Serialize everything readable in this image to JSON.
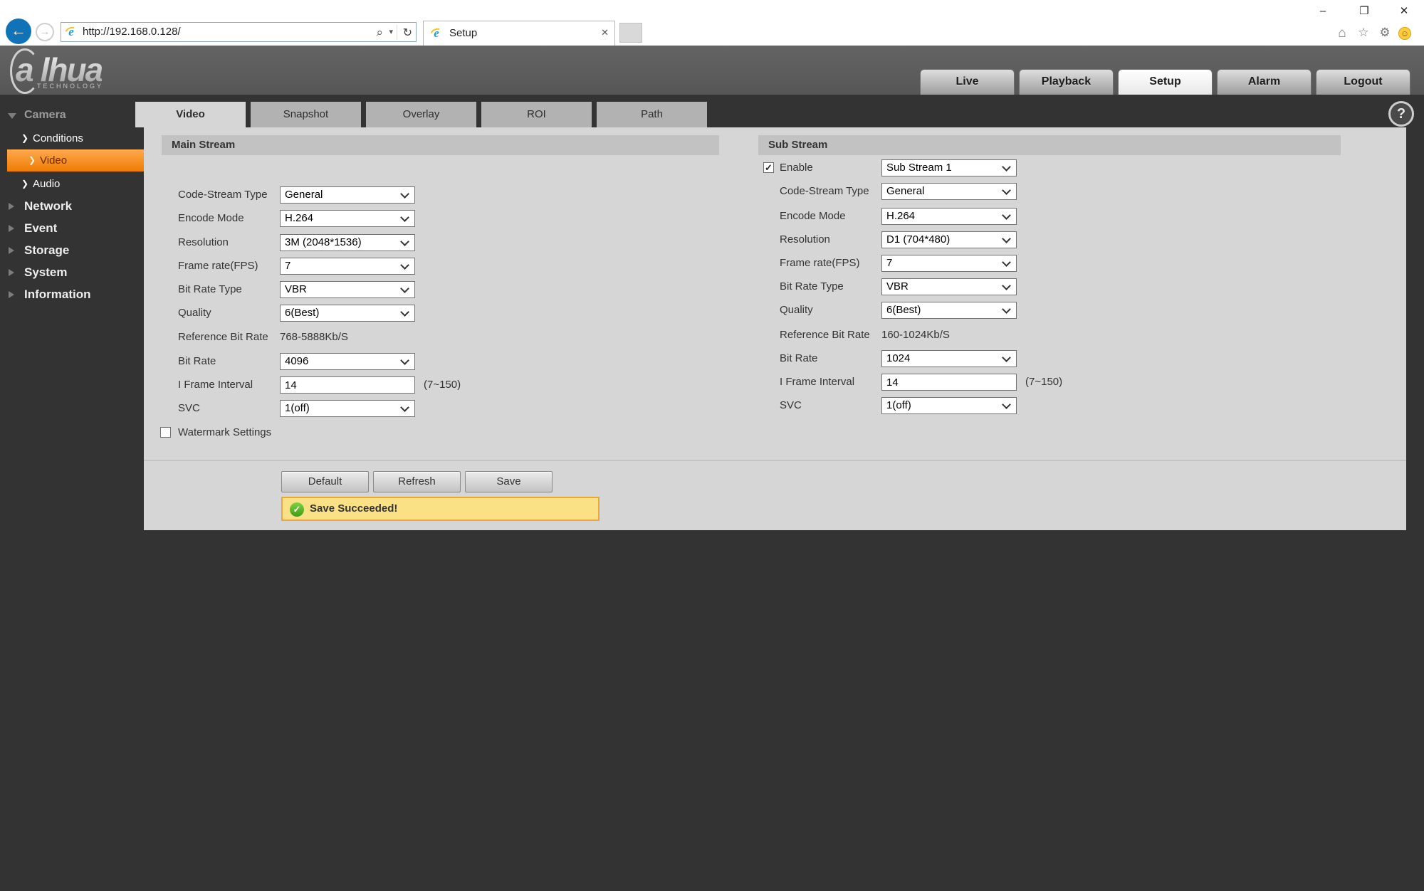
{
  "browser": {
    "url": "http://192.168.0.128/",
    "tab_title": "Setup"
  },
  "icons": {
    "back": "←",
    "forward": "→",
    "search": "⌕",
    "caret": "▾",
    "refresh": "↻",
    "close": "✕",
    "minimize": "–",
    "restore": "❐",
    "home": "⌂",
    "star": "☆",
    "gear": "⚙",
    "ie": "e",
    "check": "✓",
    "help": "?",
    "chevron": "❯",
    "smiley": "☺"
  },
  "header": {
    "logo_first": "a",
    "logo_rest": "lhua",
    "logo_subtext": "TECHNOLOGY",
    "nav": [
      {
        "label": "Live",
        "active": false
      },
      {
        "label": "Playback",
        "active": false
      },
      {
        "label": "Setup",
        "active": true
      },
      {
        "label": "Alarm",
        "active": false
      },
      {
        "label": "Logout",
        "active": false
      }
    ]
  },
  "sidebar": {
    "camera_group": {
      "label": "Camera",
      "expanded": true,
      "children": [
        {
          "label": "Conditions",
          "selected": false
        },
        {
          "label": "Video",
          "selected": true
        },
        {
          "label": "Audio",
          "selected": false
        }
      ]
    },
    "groups": [
      {
        "label": "Network"
      },
      {
        "label": "Event"
      },
      {
        "label": "Storage"
      },
      {
        "label": "System"
      },
      {
        "label": "Information"
      }
    ]
  },
  "tabs": [
    {
      "label": "Video",
      "active": true
    },
    {
      "label": "Snapshot",
      "active": false
    },
    {
      "label": "Overlay",
      "active": false
    },
    {
      "label": "ROI",
      "active": false
    },
    {
      "label": "Path",
      "active": false
    }
  ],
  "main_stream": {
    "title": "Main Stream",
    "rows": [
      {
        "label": "Code-Stream Type",
        "type": "select",
        "value": "General"
      },
      {
        "label": "Encode Mode",
        "type": "select",
        "value": "H.264"
      },
      {
        "label": "Resolution",
        "type": "select",
        "value": "3M (2048*1536)"
      },
      {
        "label": "Frame rate(FPS)",
        "type": "select",
        "value": "7"
      },
      {
        "label": "Bit Rate Type",
        "type": "select",
        "value": "VBR"
      },
      {
        "label": "Quality",
        "type": "select",
        "value": "6(Best)"
      },
      {
        "label": "Reference Bit Rate",
        "type": "static",
        "value": "768-5888Kb/S"
      },
      {
        "label": "Bit Rate",
        "type": "select",
        "value": "4096"
      },
      {
        "label": "I Frame Interval",
        "type": "input",
        "value": "14",
        "hint": "(7~150)"
      },
      {
        "label": "SVC",
        "type": "select",
        "value": "1(off)"
      }
    ],
    "watermark": {
      "label": "Watermark Settings",
      "checked": false
    }
  },
  "sub_stream": {
    "title": "Sub Stream",
    "enable": {
      "label": "Enable",
      "checked": true,
      "value": "Sub Stream 1"
    },
    "rows": [
      {
        "label": "Code-Stream Type",
        "type": "select",
        "value": "General"
      },
      {
        "label": "Encode Mode",
        "type": "select",
        "value": "H.264"
      },
      {
        "label": "Resolution",
        "type": "select",
        "value": "D1 (704*480)"
      },
      {
        "label": "Frame rate(FPS)",
        "type": "select",
        "value": "7"
      },
      {
        "label": "Bit Rate Type",
        "type": "select",
        "value": "VBR"
      },
      {
        "label": "Quality",
        "type": "select",
        "value": "6(Best)"
      },
      {
        "label": "Reference Bit Rate",
        "type": "static",
        "value": "160-1024Kb/S"
      },
      {
        "label": "Bit Rate",
        "type": "select",
        "value": "1024"
      },
      {
        "label": "I Frame Interval",
        "type": "input",
        "value": "14",
        "hint": "(7~150)"
      },
      {
        "label": "SVC",
        "type": "select",
        "value": "1(off)"
      }
    ]
  },
  "footer": {
    "buttons": [
      "Default",
      "Refresh",
      "Save"
    ],
    "message": "Save Succeeded!"
  },
  "colors": {
    "accent_orange": "#ef7c00",
    "body_dark": "#333333",
    "panel_gray": "#d6d6d6",
    "section_bar": "#c2c2c2",
    "success_green": "#3f9c14",
    "message_bg": "#fbe186",
    "message_border": "#e9a83b"
  }
}
